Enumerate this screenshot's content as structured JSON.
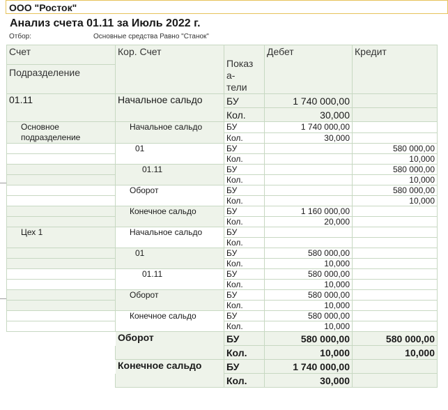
{
  "org": "ООО \"Росток\"",
  "title": "Анализ счета 01.11 за Июль 2022 г.",
  "filter": {
    "label": "Отбор:",
    "value": "Основные средства Равно \"Станок\""
  },
  "headers": {
    "account": "Счет",
    "division": "Подразделение",
    "corr_account": "Кор. Счет",
    "indicators": "Показ\nа-\nтели",
    "debit": "Дебет",
    "credit": "Кредит"
  },
  "rows": [
    {
      "a": "01.11",
      "b": "Начальное сальдо",
      "ind": "БУ",
      "d": "1 740 000,00",
      "c": ""
    },
    {
      "a": "",
      "b": "",
      "ind": "Кол.",
      "d": "30,000",
      "c": ""
    },
    {
      "a": "Основное подразделение",
      "b": "Начальное сальдо",
      "ind": "БУ",
      "d": "1 740 000,00",
      "c": ""
    },
    {
      "a": "",
      "b": "",
      "ind": "Кол.",
      "d": "30,000",
      "c": ""
    },
    {
      "a": "",
      "b": "01",
      "ind": "БУ",
      "d": "",
      "c": "580 000,00"
    },
    {
      "a": "",
      "b": "",
      "ind": "Кол.",
      "d": "",
      "c": "10,000"
    },
    {
      "a": "",
      "b": "01.11",
      "ind": "БУ",
      "d": "",
      "c": "580 000,00"
    },
    {
      "a": "",
      "b": "",
      "ind": "Кол.",
      "d": "",
      "c": "10,000"
    },
    {
      "a": "",
      "b": "Оборот",
      "ind": "БУ",
      "d": "",
      "c": "580 000,00"
    },
    {
      "a": "",
      "b": "",
      "ind": "Кол.",
      "d": "",
      "c": "10,000"
    },
    {
      "a": "",
      "b": "Конечное сальдо",
      "ind": "БУ",
      "d": "1 160 000,00",
      "c": ""
    },
    {
      "a": "",
      "b": "",
      "ind": "Кол.",
      "d": "20,000",
      "c": ""
    },
    {
      "a": "Цех 1",
      "b": "Начальное сальдо",
      "ind": "БУ",
      "d": "",
      "c": ""
    },
    {
      "a": "",
      "b": "",
      "ind": "Кол.",
      "d": "",
      "c": ""
    },
    {
      "a": "",
      "b": "01",
      "ind": "БУ",
      "d": "580 000,00",
      "c": ""
    },
    {
      "a": "",
      "b": "",
      "ind": "Кол.",
      "d": "10,000",
      "c": ""
    },
    {
      "a": "",
      "b": "01.11",
      "ind": "БУ",
      "d": "580 000,00",
      "c": ""
    },
    {
      "a": "",
      "b": "",
      "ind": "Кол.",
      "d": "10,000",
      "c": ""
    },
    {
      "a": "",
      "b": "Оборот",
      "ind": "БУ",
      "d": "580 000,00",
      "c": ""
    },
    {
      "a": "",
      "b": "",
      "ind": "Кол.",
      "d": "10,000",
      "c": ""
    },
    {
      "a": "",
      "b": "Конечное сальдо",
      "ind": "БУ",
      "d": "580 000,00",
      "c": ""
    },
    {
      "a": "",
      "b": "",
      "ind": "Кол.",
      "d": "10,000",
      "c": ""
    }
  ],
  "totals": [
    {
      "b": "Оборот",
      "ind": "БУ",
      "d": "580 000,00",
      "c": "580 000,00"
    },
    {
      "b": "",
      "ind": "Кол.",
      "d": "10,000",
      "c": "10,000"
    },
    {
      "b": "Конечное сальдо",
      "ind": "БУ",
      "d": "1 740 000,00",
      "c": ""
    },
    {
      "b": "",
      "ind": "Кол.",
      "d": "30,000",
      "c": ""
    }
  ],
  "colors": {
    "header_bg": "#eef3ea",
    "grid": "#c7d8c2",
    "org_border": "#e6c25a"
  }
}
